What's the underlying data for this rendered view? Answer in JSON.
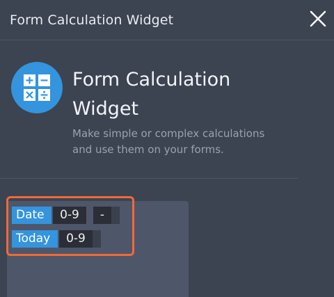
{
  "header": {
    "title": "Form Calculation Widget"
  },
  "widget": {
    "icon": "calculator-icon",
    "title_line1": "Form Calculation",
    "title_line2": "Widget",
    "description_line1": "Make simple or complex calculations",
    "description_line2": "and use them on your forms."
  },
  "preview": {
    "date_label": "Date",
    "date_digits": "0-9",
    "date_separator": "-",
    "today_label": "Today",
    "today_digits": "0-9"
  },
  "colors": {
    "background": "#3c4351",
    "accent": "#3494dd",
    "highlight": "#f26a35",
    "preview_card": "#4e5769"
  }
}
